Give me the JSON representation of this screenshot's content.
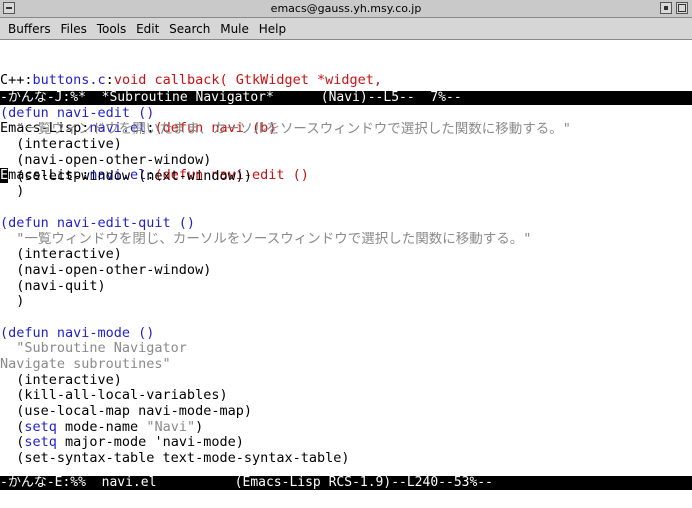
{
  "window": {
    "title": "emacs@gauss.yh.msy.co.jp"
  },
  "menu": [
    "Buffers",
    "Files",
    "Tools",
    "Edit",
    "Search",
    "Mule",
    "Help"
  ],
  "navi_lines": [
    {
      "prefix": "C++:",
      "file": "buttons.c",
      "sep": ":",
      "def": "void callback( GtkWidget *widget,"
    },
    {
      "prefix": "Emacs-Lisp:",
      "file": "navi.el",
      "sep": ":",
      "def": "(defun navi (b)"
    },
    {
      "prefix": "Emacs-Lisp:",
      "file": "navi.el",
      "sep": ":",
      "def": "(defun navi-edit ()"
    }
  ],
  "modeline_top": "-かんな-J:%*  *Subroutine Navigator*      (Navi)--L5--  7%--",
  "code_lines": [
    {
      "segments": [
        {
          "t": "(defun navi-edit ()",
          "c": "blue"
        }
      ]
    },
    {
      "segments": [
        {
          "t": "  \"一覧ウィンドウを開いたまま、カーソルをソースウィンドウで選択した関数に移動する。\"",
          "c": "gray"
        }
      ]
    },
    {
      "segments": [
        {
          "t": "  (interactive)",
          "c": ""
        }
      ]
    },
    {
      "segments": [
        {
          "t": "  (navi-open-other-window)",
          "c": ""
        }
      ]
    },
    {
      "segments": [
        {
          "t": "  (select-window (next-window))",
          "c": ""
        }
      ]
    },
    {
      "segments": [
        {
          "t": "  )",
          "c": ""
        }
      ]
    },
    {
      "segments": [
        {
          "t": "",
          "c": ""
        }
      ]
    },
    {
      "segments": [
        {
          "t": "(defun navi-edit-quit ()",
          "c": "blue"
        }
      ]
    },
    {
      "segments": [
        {
          "t": "  \"一覧ウィンドウを閉じ、カーソルをソースウィンドウで選択した関数に移動する。\"",
          "c": "gray"
        }
      ]
    },
    {
      "segments": [
        {
          "t": "  (interactive)",
          "c": ""
        }
      ]
    },
    {
      "segments": [
        {
          "t": "  (navi-open-other-window)",
          "c": ""
        }
      ]
    },
    {
      "segments": [
        {
          "t": "  (navi-quit)",
          "c": ""
        }
      ]
    },
    {
      "segments": [
        {
          "t": "  )",
          "c": ""
        }
      ]
    },
    {
      "segments": [
        {
          "t": "",
          "c": ""
        }
      ]
    },
    {
      "segments": [
        {
          "t": "(defun navi-mode ()",
          "c": "blue"
        }
      ]
    },
    {
      "segments": [
        {
          "t": "  \"Subroutine Navigator",
          "c": "gray"
        }
      ]
    },
    {
      "segments": [
        {
          "t": "Navigate subroutines\"",
          "c": "gray"
        }
      ]
    },
    {
      "segments": [
        {
          "t": "  (interactive)",
          "c": ""
        }
      ]
    },
    {
      "segments": [
        {
          "t": "  (kill-all-local-variables)",
          "c": ""
        }
      ]
    },
    {
      "segments": [
        {
          "t": "  (use-local-map navi-mode-map)",
          "c": ""
        }
      ]
    },
    {
      "segments": [
        {
          "t": "  (",
          "c": ""
        },
        {
          "t": "setq",
          "c": "blue"
        },
        {
          "t": " mode-name ",
          "c": ""
        },
        {
          "t": "\"Navi\"",
          "c": "gray"
        },
        {
          "t": ")",
          "c": ""
        }
      ]
    },
    {
      "segments": [
        {
          "t": "  (",
          "c": ""
        },
        {
          "t": "setq",
          "c": "blue"
        },
        {
          "t": " major-mode 'navi-mode)",
          "c": ""
        }
      ]
    },
    {
      "segments": [
        {
          "t": "  (set-syntax-table text-mode-syntax-table)",
          "c": ""
        }
      ]
    }
  ],
  "modeline_bottom": "-かんな-E:%%  navi.el          (Emacs-Lisp RCS-1.9)--L240--53%--",
  "colors": {
    "link": "#1f1fcc",
    "keyword": "#cc1010",
    "comment": "#8a8a8a",
    "modeline_bg": "#000000"
  }
}
